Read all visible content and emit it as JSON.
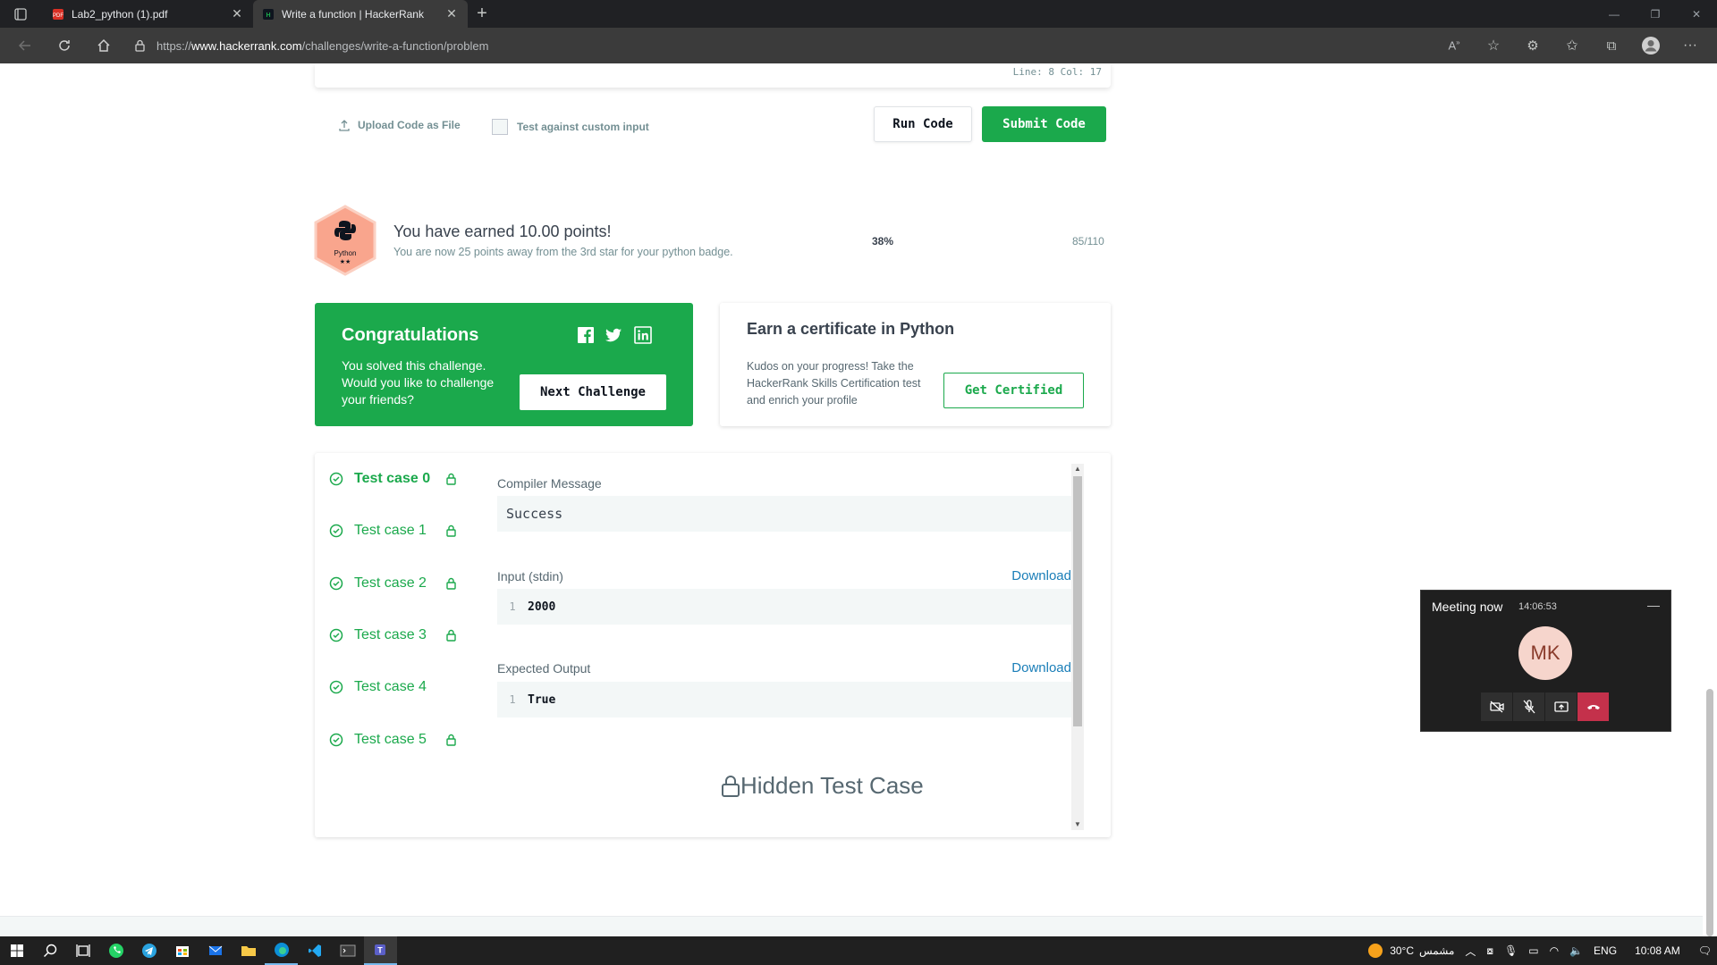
{
  "browser": {
    "tabs": [
      {
        "title": "Lab2_python (1).pdf",
        "icon": "pdf-icon"
      },
      {
        "title": "Write a function | HackerRank",
        "icon": "hackerrank-icon"
      }
    ],
    "url_prefix": "https://",
    "url_domain": "www.hackerrank.com",
    "url_path": "/challenges/write-a-function/problem"
  },
  "editor": {
    "line_col": "Line: 8  Col: 17",
    "upload_label": "Upload Code as File",
    "custom_input_label": "Test against custom input",
    "run_label": "Run Code",
    "submit_label": "Submit Code"
  },
  "points": {
    "badge_label": "Python",
    "badge_stars": "★★",
    "title": "You have earned 10.00 points!",
    "subtitle": "You are now 25 points away from the 3rd star for your python badge.",
    "percent": "38%",
    "count": "85/110"
  },
  "congrats": {
    "title": "Congratulations",
    "text": "You solved this challenge. Would you like to challenge your friends?",
    "next_label": "Next Challenge"
  },
  "certificate": {
    "title": "Earn a certificate in Python",
    "text": "Kudos on your progress! Take the HackerRank Skills Certification test and enrich your profile",
    "button_label": "Get Certified"
  },
  "test_cases": {
    "items": [
      {
        "label": "Test case 0",
        "locked": true,
        "active": true
      },
      {
        "label": "Test case 1",
        "locked": true,
        "active": false
      },
      {
        "label": "Test case 2",
        "locked": true,
        "active": false
      },
      {
        "label": "Test case 3",
        "locked": true,
        "active": false
      },
      {
        "label": "Test case 4",
        "locked": false,
        "active": false
      },
      {
        "label": "Test case 5",
        "locked": true,
        "active": false
      }
    ],
    "compiler_heading": "Compiler Message",
    "compiler_value": "Success",
    "input_heading": "Input (stdin)",
    "input_line": "1",
    "input_value": "2000",
    "expected_heading": "Expected Output",
    "expected_line": "1",
    "expected_value": "True",
    "download_label": "Download",
    "hidden_label": "Hidden Test Case"
  },
  "meeting": {
    "title": "Meeting now",
    "time": "14:06:53",
    "initials": "MK"
  },
  "taskbar": {
    "temperature": "30°C",
    "weather_text": "مشمس",
    "language": "ENG",
    "clock": "10:08 AM"
  },
  "colors": {
    "green": "#1ba94c",
    "link": "#1a7eb8",
    "badge": "#f9a58d"
  }
}
